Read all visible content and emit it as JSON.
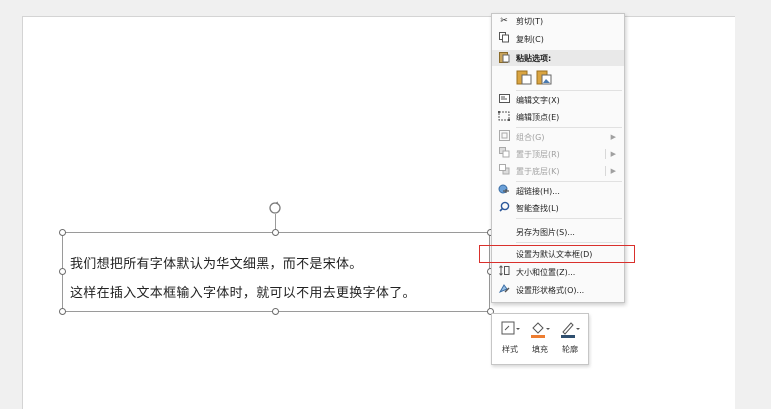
{
  "textbox": {
    "line1": "我们想把所有字体默认为华文细黑，而不是宋体。",
    "line2": "这样在插入文本框输入字体时，就可以不用去更换字体了。"
  },
  "context_menu": {
    "cut": "剪切(T)",
    "copy": "复制(C)",
    "paste_options_header": "粘贴选项:",
    "edit_text": "编辑文字(X)",
    "edit_points": "编辑顶点(E)",
    "group": "组合(G)",
    "bring_to_front": "置于顶层(R)",
    "send_to_back": "置于底层(K)",
    "hyperlink": "超链接(H)...",
    "smart_lookup": "智能查找(L)",
    "save_as_picture": "另存为图片(S)...",
    "set_default_textbox": "设置为默认文本框(D)",
    "size_position": "大小和位置(Z)...",
    "format_shape": "设置形状格式(O)..."
  },
  "mini_toolbar": {
    "style": "样式",
    "fill": "填充",
    "outline": "轮廓"
  },
  "colors": {
    "highlight_border": "#d9302c",
    "fill_accent": "#ed7d31",
    "outline_accent": "#2f4f6f"
  }
}
